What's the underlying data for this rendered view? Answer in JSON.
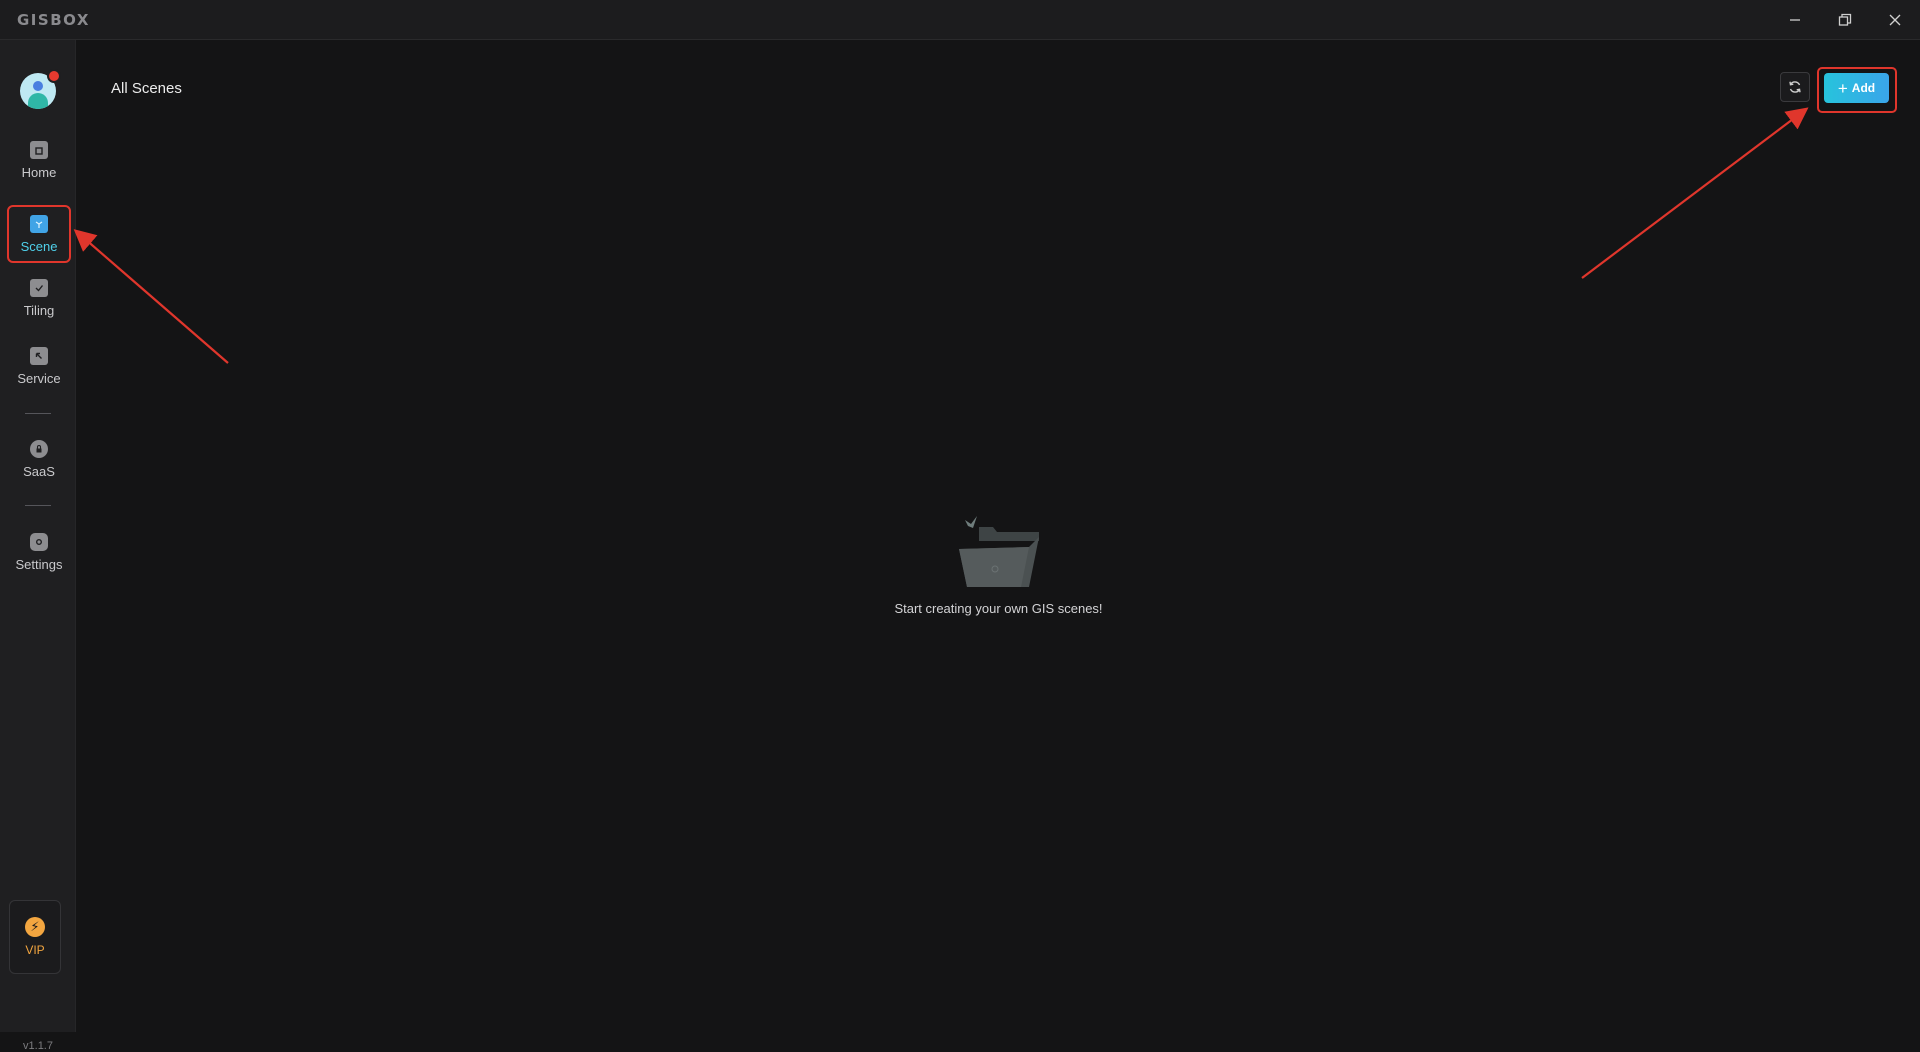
{
  "app": {
    "logo_text": "GISBOX"
  },
  "window_controls": [
    "minimize-icon",
    "restore-icon",
    "close-icon"
  ],
  "sidebar": {
    "items": [
      {
        "label": "Home",
        "icon": "home-icon"
      },
      {
        "label": "Scene",
        "icon": "cube-icon",
        "active": true
      },
      {
        "label": "Tiling",
        "icon": "tiling-icon"
      },
      {
        "label": "Service",
        "icon": "service-icon"
      },
      {
        "label": "SaaS",
        "icon": "lock-icon"
      },
      {
        "label": "Settings",
        "icon": "gear-icon"
      }
    ],
    "vip_label": "VIP",
    "version": "v1.1.7"
  },
  "main": {
    "title": "All Scenes",
    "add_label": "Add",
    "empty_text": "Start creating your own GIS scenes!"
  },
  "colors": {
    "accent": "#27c3dc",
    "highlight": "#e0362c",
    "vip": "#f3a640",
    "active_label": "#4fd0ea"
  }
}
